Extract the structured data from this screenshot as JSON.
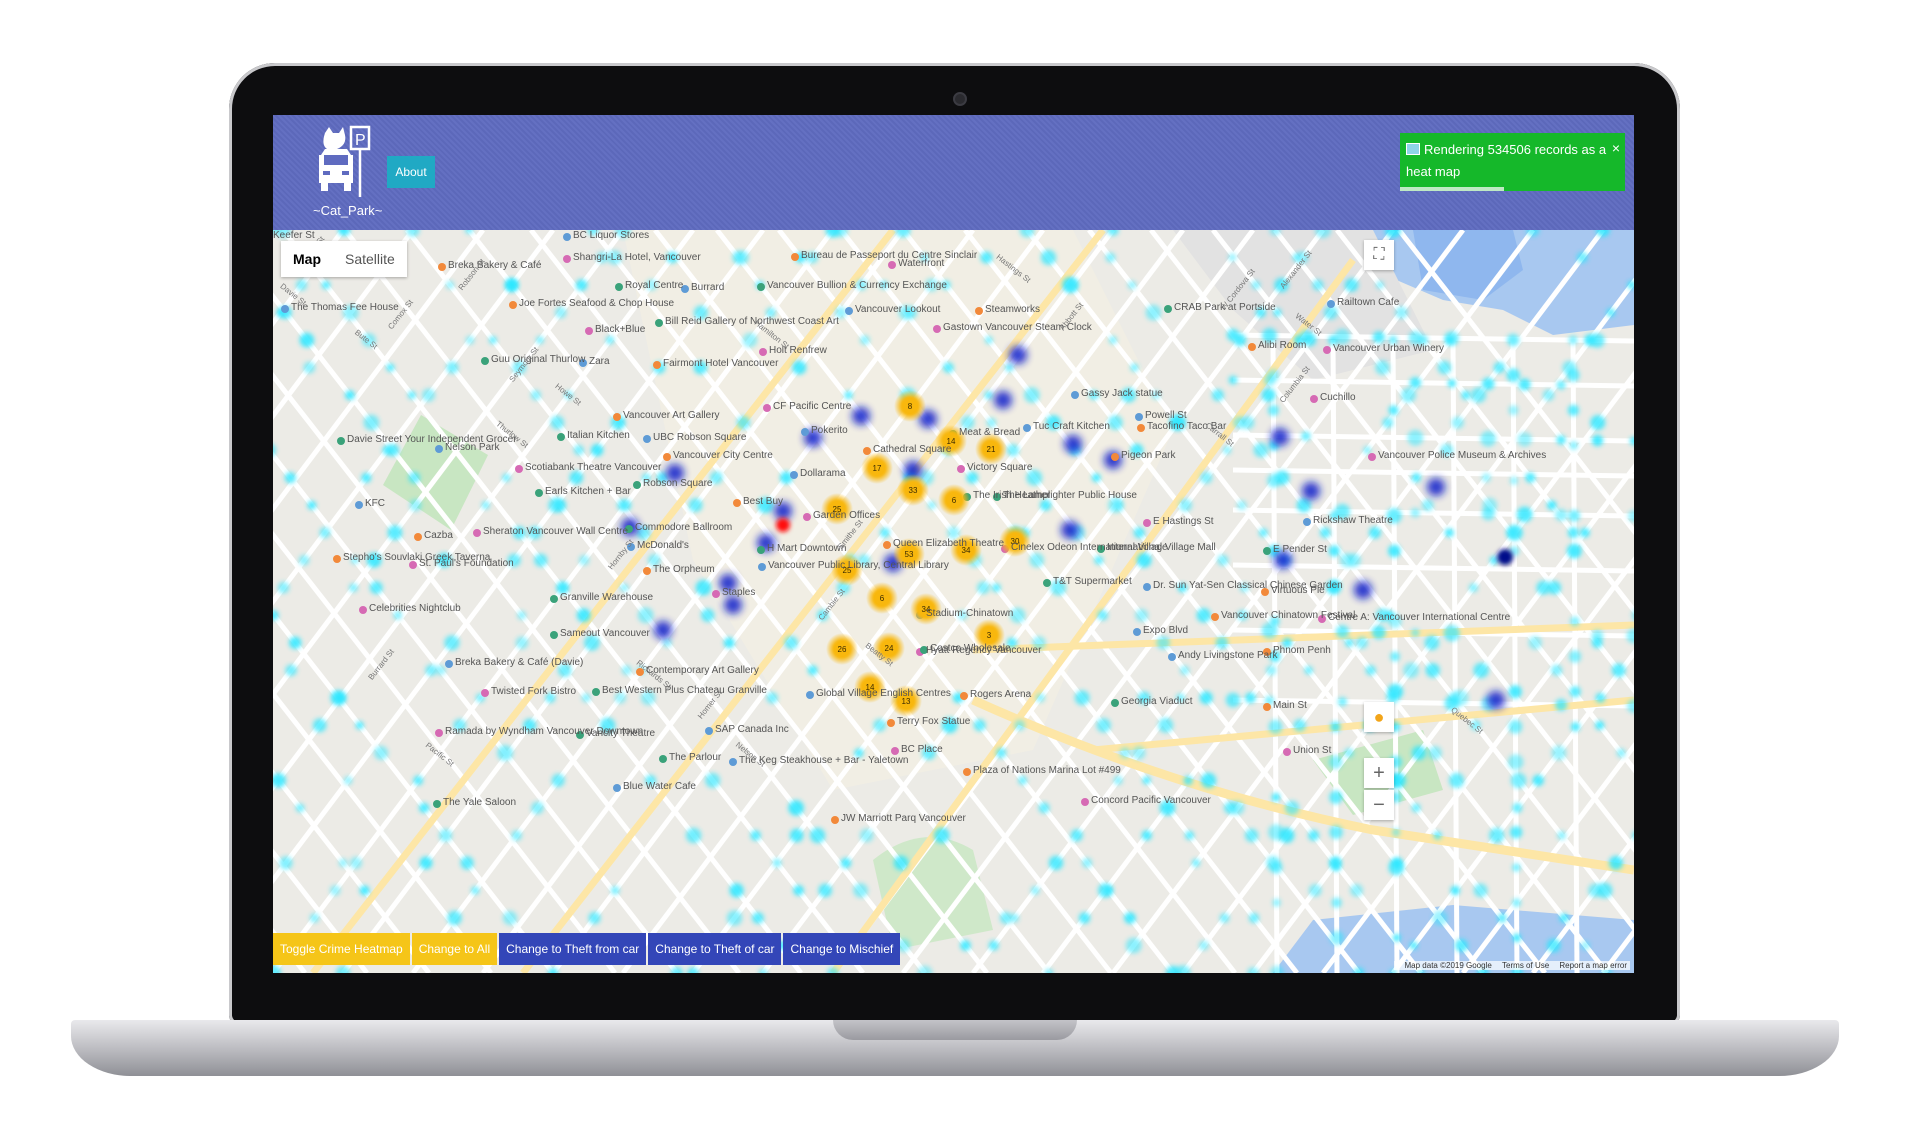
{
  "app": {
    "logo_text": "~Cat_Park~",
    "about_label": "About"
  },
  "notification": {
    "text": "Rendering 534506 records as a heat map",
    "close_glyph": "×",
    "progress_fraction": 0.46
  },
  "map": {
    "type_buttons": [
      "Map",
      "Satellite"
    ],
    "selected_type": "Map",
    "zoom_in": "+",
    "zoom_out": "−",
    "fullscreen_glyph": "⛶",
    "legal": {
      "data": "Map data ©2019 Google",
      "terms": "Terms of Use",
      "report": "Report a map error"
    },
    "labels": [
      "BC Liquor Stores",
      "Breka Bakery & Café",
      "Shangri-La Hotel, Vancouver",
      "Royal Centre",
      "Burrard",
      "Bureau de Passeport du Centre Sinclair",
      "Waterfront",
      "Vancouver Bullion & Currency Exchange",
      "The Thomas Fee House",
      "Joe Fortes Seafood & Chop House",
      "Black+Blue",
      "Bill Reid Gallery of Northwest Coast Art",
      "Vancouver Lookout",
      "Steamworks",
      "Gastown Vancouver Steam Clock",
      "Guu Original Thurlow",
      "Zara",
      "Fairmont Hotel Vancouver",
      "Holt Renfrew",
      "CRAB Park at Portside",
      "Railtown Cafe",
      "Alibi Room",
      "Vancouver Urban Winery",
      "Davie Street Your Independent Grocer",
      "Nelson Park",
      "Vancouver Art Gallery",
      "CF Pacific Centre",
      "Italian Kitchen",
      "UBC Robson Square",
      "Vancouver City Centre",
      "Scotiabank Theatre Vancouver",
      "Robson Square",
      "Pokerito",
      "Cathedral Square",
      "Victory Square",
      "The Irish Heather",
      "Gassy Jack statue",
      "Tacofino Taco Bar",
      "Cuchillo",
      "Meat & Bread",
      "Tuc Craft Kitchen",
      "Pigeon Park",
      "Vancouver Police Museum & Archives",
      "Earls Kitchen + Bar",
      "Dollarama",
      "Best Buy",
      "Garden Offices",
      "The Lamplighter Public House",
      "KFC",
      "Cazba",
      "Sheraton Vancouver Wall Centre",
      "Commodore Ballroom",
      "McDonald's",
      "Queen Elizabeth Theatre",
      "Cinelex Odeon International Village",
      "International Village Mall",
      "Rickshaw Theatre",
      "Stepho's Souvlaki Greek Taverna",
      "St. Paul's Foundation",
      "H Mart Downtown",
      "Vancouver Public Library, Central Library",
      "The Orpheum",
      "Staples",
      "T&T Supermarket",
      "Dr. Sun Yat-Sen Classical Chinese Garden",
      "Virtuous Pie",
      "Celebrities Nightclub",
      "Granville Warehouse",
      "Stadium-Chinatown",
      "Vancouver Chinatown Festival",
      "Centre A: Vancouver International Centre",
      "Sameout Vancouver",
      "Breka Bakery & Café (Davie)",
      "Contemporary Art Gallery",
      "Hyatt Regency Vancouver",
      "Costco Wholesale",
      "Andy Livingstone Park",
      "Phnom Penh",
      "Twisted Fork Bistro",
      "Best Western Plus Chateau Granville",
      "Global Village English Centres",
      "Rogers Arena",
      "Ramada by Wyndham Vancouver Downtown",
      "Vancity Theatre",
      "SAP Canada Inc",
      "Terry Fox Statue",
      "BC Place",
      "The Parlour",
      "The Keg Steakhouse + Bar - Yaletown",
      "Plaza of Nations Marina Lot #499",
      "Concord Pacific Vancouver",
      "The Yale Saloon",
      "Blue Water Cafe",
      "JW Marriott Parq Vancouver",
      "E Hastings St",
      "E Pender St",
      "Powell St",
      "Main St",
      "Union St",
      "Georgia Viaduct",
      "Expo Blvd",
      "Keefer St"
    ],
    "street_labels": [
      "Davie St",
      "Burrard St",
      "Thurlow St",
      "Hornby St",
      "Howe St",
      "Seymour St",
      "Richards St",
      "Homer St",
      "Hamilton St",
      "Cambie St",
      "Beatty St",
      "Smithe St",
      "Nelson St",
      "Robson St",
      "Pacific St",
      "Abbott St",
      "Carrall St",
      "Columbia St",
      "Quebec St",
      "Alexander St",
      "Water St",
      "W Cordova St",
      "Hastings St",
      "Jervis St",
      "Bute St",
      "Comox St"
    ],
    "clusters": [
      {
        "count": 8
      },
      {
        "count": 14
      },
      {
        "count": 21
      },
      {
        "count": 17
      },
      {
        "count": 33
      },
      {
        "count": 25
      },
      {
        "count": 6
      },
      {
        "count": 30
      },
      {
        "count": 53
      },
      {
        "count": 34
      },
      {
        "count": 25
      },
      {
        "count": 6
      },
      {
        "count": 34
      },
      {
        "count": 3
      },
      {
        "count": 26
      },
      {
        "count": 24
      },
      {
        "count": 14
      },
      {
        "count": 13
      }
    ]
  },
  "actions": [
    {
      "label": "Toggle Crime Heatmap",
      "style": "yellow"
    },
    {
      "label": "Change to All",
      "style": "yellow"
    },
    {
      "label": "Change to Theft from car",
      "style": "blue"
    },
    {
      "label": "Change to Theft of car",
      "style": "blue"
    },
    {
      "label": "Change to Mischief",
      "style": "blue"
    }
  ],
  "colors": {
    "header": "#5f6bc0",
    "about": "#20a9c4",
    "notification": "#15b82a",
    "button_yellow": "#f5c518",
    "button_blue": "#3346b8",
    "heat_low": "#27e6ff",
    "heat_high": "#0a1cc9",
    "heat_peak": "#ff1010",
    "cluster": "#f8b70d"
  }
}
